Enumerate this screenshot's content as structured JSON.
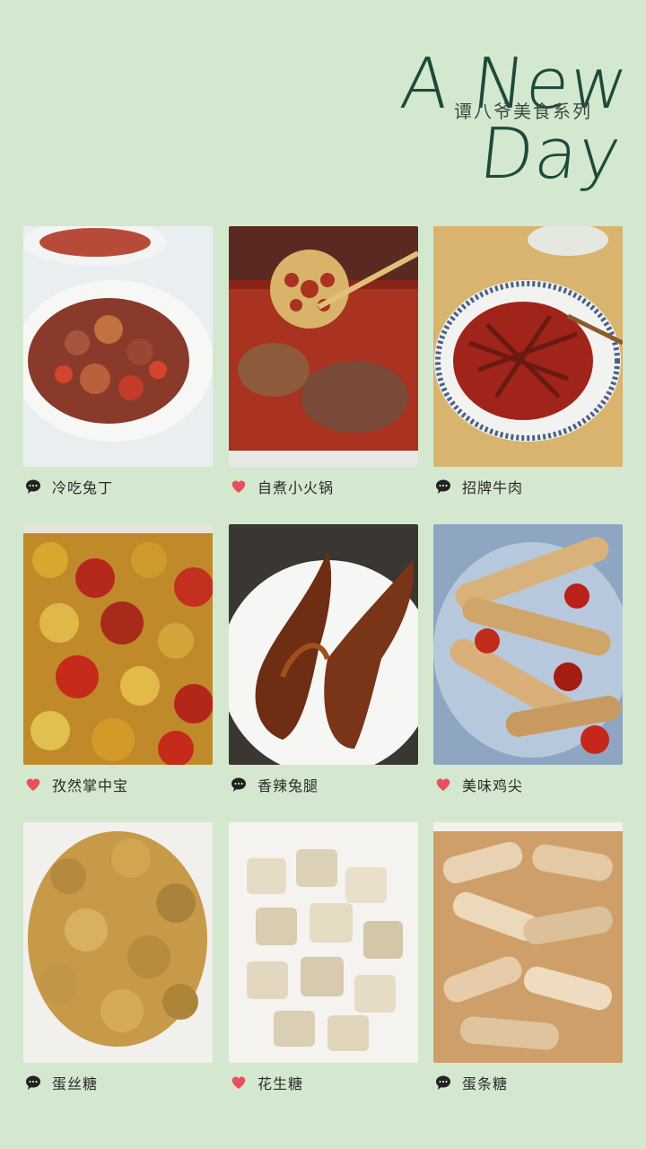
{
  "header": {
    "title": "A New Day",
    "subtitle": "谭八爷美食系列"
  },
  "items": [
    {
      "label": "冷吃兔丁",
      "icon": "comment-icon"
    },
    {
      "label": "自煮小火锅",
      "icon": "heart-icon"
    },
    {
      "label": "招牌牛肉",
      "icon": "comment-icon"
    },
    {
      "label": "孜然掌中宝",
      "icon": "heart-icon"
    },
    {
      "label": "香辣兔腿",
      "icon": "comment-icon"
    },
    {
      "label": "美味鸡尖",
      "icon": "heart-icon"
    },
    {
      "label": "蛋丝糖",
      "icon": "comment-icon"
    },
    {
      "label": "花生糖",
      "icon": "heart-icon"
    },
    {
      "label": "蛋条糖",
      "icon": "comment-icon"
    }
  ],
  "colors": {
    "background": "#d4e8cf",
    "title": "#1e4a3a",
    "heart": "#e8505b",
    "comment": "#222222"
  }
}
